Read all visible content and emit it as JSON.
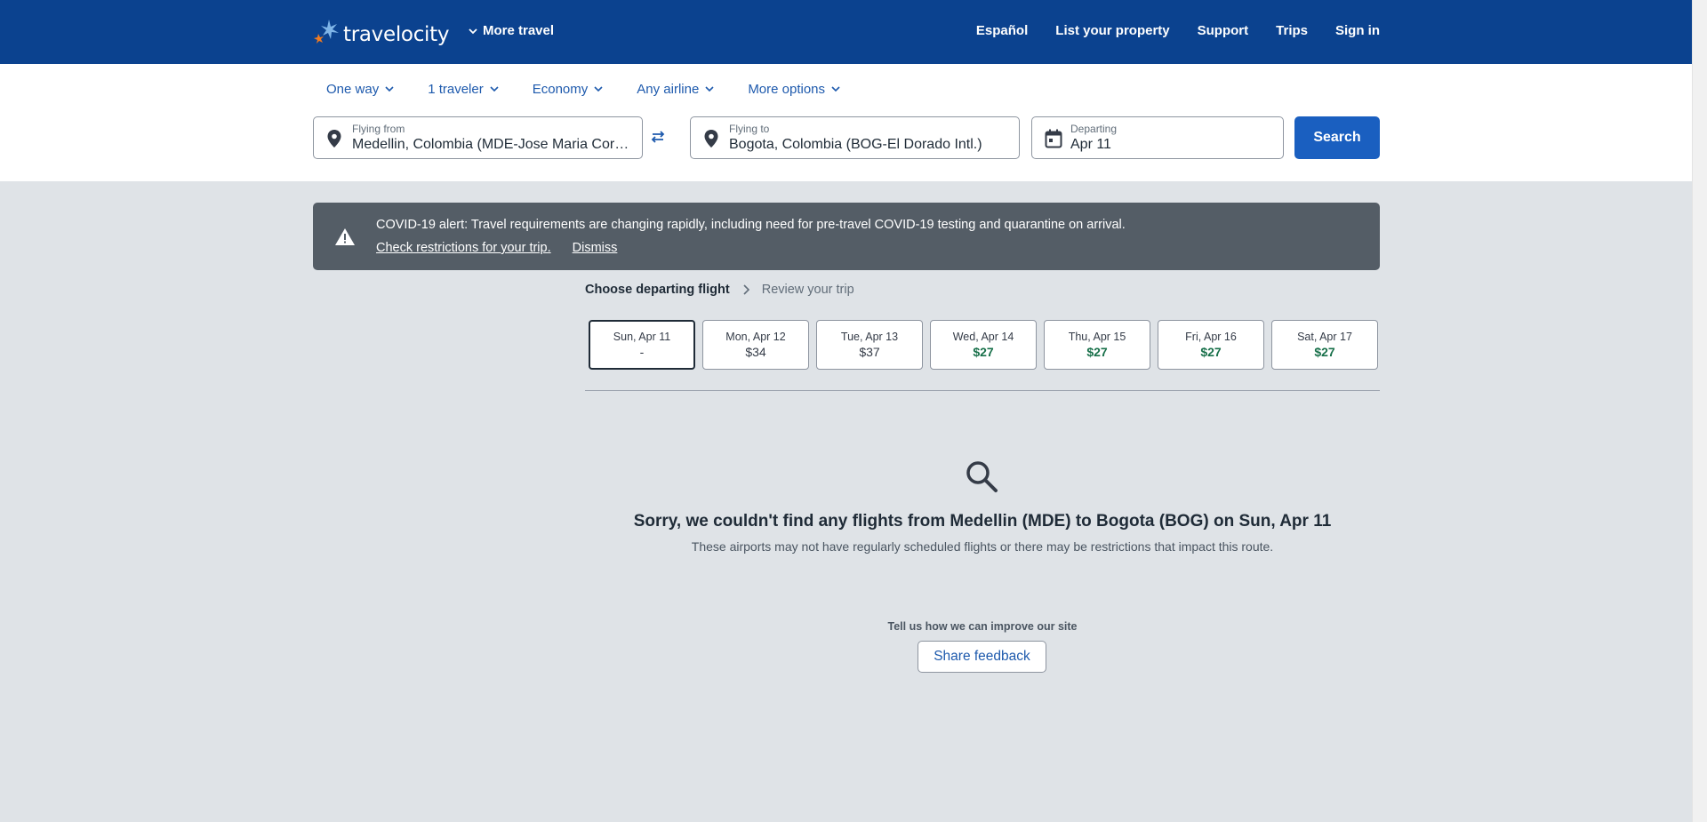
{
  "header": {
    "logo_text": "travelocity",
    "more_travel": "More travel",
    "nav": [
      "Español",
      "List your property",
      "Support",
      "Trips",
      "Sign in"
    ]
  },
  "search": {
    "options": [
      "One way",
      "1 traveler",
      "Economy",
      "Any airline",
      "More options"
    ],
    "from_label": "Flying from",
    "from_value": "Medellin, Colombia (MDE-Jose Maria Cordova Intl.)",
    "to_label": "Flying to",
    "to_value": "Bogota, Colombia (BOG-El Dorado Intl.)",
    "depart_label": "Departing",
    "depart_value": "Apr 11",
    "search_button": "Search"
  },
  "alert": {
    "message": "COVID-19 alert: Travel requirements are changing rapidly, including need for pre-travel COVID-19 testing and quarantine on arrival.",
    "link_restrictions": "Check restrictions for your trip.",
    "link_dismiss": "Dismiss"
  },
  "breadcrumb": {
    "active": "Choose departing flight",
    "next": "Review your trip"
  },
  "dates": [
    {
      "date": "Sun, Apr 11",
      "price": "-",
      "selected": true,
      "deal": false
    },
    {
      "date": "Mon, Apr 12",
      "price": "$34",
      "selected": false,
      "deal": false
    },
    {
      "date": "Tue, Apr 13",
      "price": "$37",
      "selected": false,
      "deal": false
    },
    {
      "date": "Wed, Apr 14",
      "price": "$27",
      "selected": false,
      "deal": true
    },
    {
      "date": "Thu, Apr 15",
      "price": "$27",
      "selected": false,
      "deal": true
    },
    {
      "date": "Fri, Apr 16",
      "price": "$27",
      "selected": false,
      "deal": true
    },
    {
      "date": "Sat, Apr 17",
      "price": "$27",
      "selected": false,
      "deal": true
    }
  ],
  "empty": {
    "title": "Sorry, we couldn't find any flights from Medellin (MDE) to Bogota (BOG) on Sun, Apr 11",
    "subtitle": "These airports may not have regularly scheduled flights or there may be restrictions that impact this route.",
    "feedback_question": "Tell us how we can improve our site",
    "feedback_button": "Share feedback"
  },
  "colors": {
    "header_bg": "#0b428f",
    "primary": "#1a5fc0",
    "deal_green": "#18704a",
    "alert_bg": "#545d66"
  }
}
